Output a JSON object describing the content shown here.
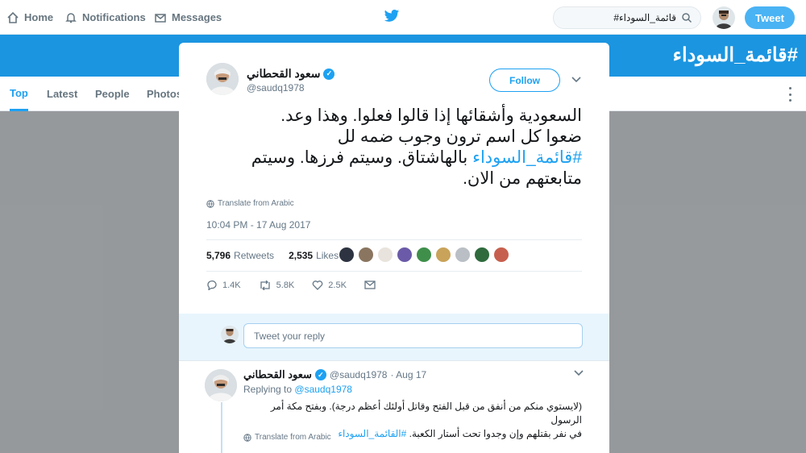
{
  "nav": {
    "home": "Home",
    "notifications": "Notifications",
    "messages": "Messages",
    "search_value": "#قائمة_السوداء",
    "tweet_button": "Tweet"
  },
  "banner": {
    "title": "#قائمة_السوداء"
  },
  "tabs": [
    "Top",
    "Latest",
    "People",
    "Photos"
  ],
  "tweet": {
    "author_name": "سعود القحطاني",
    "handle": "@saudq1978",
    "follow_label": "Follow",
    "text_line1": "السعودية وأشقائها إذا قالوا فعلوا.  وهذا وعد.",
    "text_line2": "ضعوا كل اسم ترون وجوب ضمه لل",
    "text_hashtag": "#قائمة_السوداء",
    "text_line3": " بالهاشتاق.  وسيتم فرزها. وسيتم",
    "text_line4": "متابعتهم من الان.",
    "translate": "Translate from Arabic",
    "timestamp": "10:04 PM - 17 Aug 2017",
    "retweets_count": "5,796",
    "retweets_label": "Retweets",
    "likes_count": "2,535",
    "likes_label": "Likes",
    "reply_count": "1.4K",
    "retweet_count_short": "5.8K",
    "like_count_short": "2.5K"
  },
  "reply_box": {
    "placeholder": "Tweet your reply"
  },
  "reply_tweet": {
    "author_name": "سعود القحطاني",
    "handle": "@saudq1978",
    "date": "· Aug 17",
    "replying_prefix": "Replying to",
    "replying_to": "@saudq1978",
    "text_line1": "(لايستوي منكم من أنفق من قبل الفتح وقاتل أولئك أعظم درجة). وبفتح مكة أمر الرسول",
    "text_line2": "في نفر بقتلهم وإن وجدوا تحت أستار الكعبة.",
    "text_hashtag": "#القائمة_السوداء",
    "translate": "Translate from Arabic"
  },
  "colors": {
    "accent": "#1da1f2",
    "banner": "#1b95e0",
    "tweet_button": "#4ab3f4"
  }
}
